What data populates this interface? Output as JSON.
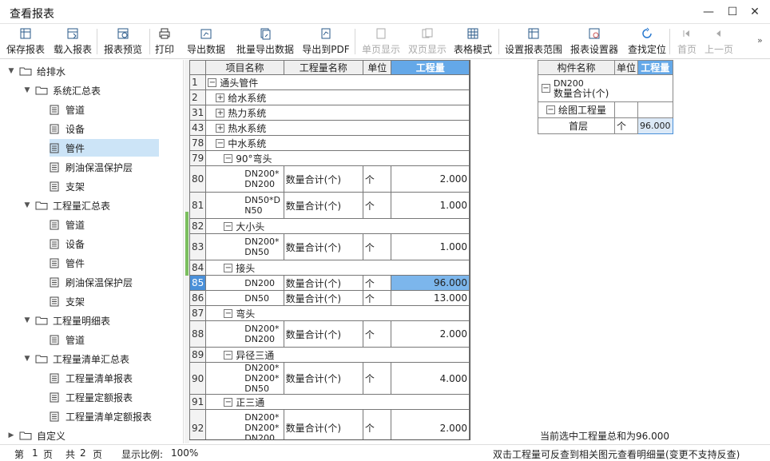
{
  "window": {
    "title": "查看报表"
  },
  "toolbar": {
    "items": [
      {
        "label": "保存报表",
        "icon": "table-save-icon"
      },
      {
        "label": "载入报表",
        "icon": "table-load-icon"
      },
      {
        "label": "报表预览",
        "icon": "table-preview-icon"
      },
      {
        "label": "打印",
        "icon": "printer-icon"
      },
      {
        "label": "导出数据",
        "icon": "export-data-icon"
      },
      {
        "label": "批量导出数据",
        "icon": "batch-export-icon"
      },
      {
        "label": "导出到PDF",
        "icon": "pdf-export-icon"
      },
      {
        "label": "单页显示",
        "icon": "single-page-icon"
      },
      {
        "label": "双页显示",
        "icon": "double-page-icon"
      },
      {
        "label": "表格模式",
        "icon": "grid-mode-icon"
      },
      {
        "label": "设置报表范围",
        "icon": "report-range-icon"
      },
      {
        "label": "报表设置器",
        "icon": "report-settings-icon"
      },
      {
        "label": "查找定位",
        "icon": "locate-icon"
      },
      {
        "label": "首页",
        "icon": "first-page-icon"
      },
      {
        "label": "上一页",
        "icon": "prev-page-icon"
      }
    ]
  },
  "tree": [
    {
      "label": "给排水",
      "level": 0,
      "type": "folder",
      "expanded": true
    },
    {
      "label": "系统汇总表",
      "level": 1,
      "type": "folder",
      "expanded": true
    },
    {
      "label": "管道",
      "level": 2,
      "type": "doc"
    },
    {
      "label": "设备",
      "level": 2,
      "type": "doc"
    },
    {
      "label": "管件",
      "level": 2,
      "type": "doc",
      "selected": true
    },
    {
      "label": "刷油保温保护层",
      "level": 2,
      "type": "doc"
    },
    {
      "label": "支架",
      "level": 2,
      "type": "doc"
    },
    {
      "label": "工程量汇总表",
      "level": 1,
      "type": "folder",
      "expanded": true
    },
    {
      "label": "管道",
      "level": 2,
      "type": "doc"
    },
    {
      "label": "设备",
      "level": 2,
      "type": "doc"
    },
    {
      "label": "管件",
      "level": 2,
      "type": "doc"
    },
    {
      "label": "刷油保温保护层",
      "level": 2,
      "type": "doc"
    },
    {
      "label": "支架",
      "level": 2,
      "type": "doc"
    },
    {
      "label": "工程量明细表",
      "level": 1,
      "type": "folder",
      "expanded": true
    },
    {
      "label": "管道",
      "level": 2,
      "type": "doc"
    },
    {
      "label": "工程量清单汇总表",
      "level": 1,
      "type": "folder",
      "expanded": true
    },
    {
      "label": "工程量清单报表",
      "level": 2,
      "type": "doc"
    },
    {
      "label": "工程量定额报表",
      "level": 2,
      "type": "doc"
    },
    {
      "label": "工程量清单定额报表",
      "level": 2,
      "type": "doc"
    },
    {
      "label": "自定义",
      "level": 0,
      "type": "folder",
      "expanded": false
    }
  ],
  "main_table": {
    "headers": [
      "项目名称",
      "工程量名称",
      "单位",
      "工程量"
    ],
    "rows": [
      {
        "n": "1",
        "kind": "group",
        "indent": 0,
        "sign": "−",
        "label": "通头管件"
      },
      {
        "n": "2",
        "kind": "group",
        "indent": 1,
        "sign": "+",
        "label": "给水系统"
      },
      {
        "n": "31",
        "kind": "group",
        "indent": 1,
        "sign": "+",
        "label": "热力系统"
      },
      {
        "n": "43",
        "kind": "group",
        "indent": 1,
        "sign": "+",
        "label": "热水系统"
      },
      {
        "n": "78",
        "kind": "group",
        "indent": 1,
        "sign": "−",
        "label": "中水系统"
      },
      {
        "n": "79",
        "kind": "group",
        "indent": 2,
        "sign": "−",
        "label": "90°弯头"
      },
      {
        "n": "80",
        "kind": "item",
        "name": "DN200*DN200",
        "qname": "数量合计(个)",
        "unit": "个",
        "value": "2.000",
        "tall": true
      },
      {
        "n": "81",
        "kind": "item",
        "name": "DN50*DN50",
        "qname": "数量合计(个)",
        "unit": "个",
        "value": "1.000",
        "tall": true
      },
      {
        "n": "82",
        "kind": "group",
        "indent": 2,
        "sign": "−",
        "label": "大小头"
      },
      {
        "n": "83",
        "kind": "item",
        "name": "DN200*DN50",
        "qname": "数量合计(个)",
        "unit": "个",
        "value": "1.000",
        "tall": true
      },
      {
        "n": "84",
        "kind": "group",
        "indent": 2,
        "sign": "−",
        "label": "接头"
      },
      {
        "n": "85",
        "kind": "item",
        "name": "DN200",
        "qname": "数量合计(个)",
        "unit": "个",
        "value": "96.000",
        "current": true
      },
      {
        "n": "86",
        "kind": "item",
        "name": "DN50",
        "qname": "数量合计(个)",
        "unit": "个",
        "value": "13.000"
      },
      {
        "n": "87",
        "kind": "group",
        "indent": 2,
        "sign": "−",
        "label": "弯头"
      },
      {
        "n": "88",
        "kind": "item",
        "name": "DN200*DN200",
        "qname": "数量合计(个)",
        "unit": "个",
        "value": "2.000",
        "tall": true
      },
      {
        "n": "89",
        "kind": "group",
        "indent": 2,
        "sign": "−",
        "label": "异径三通"
      },
      {
        "n": "90",
        "kind": "item",
        "name": "DN200*DN200*DN50",
        "qname": "数量合计(个)",
        "unit": "个",
        "value": "4.000",
        "tall": true
      },
      {
        "n": "91",
        "kind": "group",
        "indent": 2,
        "sign": "−",
        "label": "正三通"
      },
      {
        "n": "92",
        "kind": "item",
        "name": "DN200*DN200*DN200",
        "qname": "数量合计(个)",
        "unit": "个",
        "value": "2.000",
        "tall3": true
      }
    ]
  },
  "side_table": {
    "headers": [
      "构件名称",
      "单位",
      "工程量"
    ],
    "group_title_1": "DN200",
    "group_title_2": "数量合计(个)",
    "sub_group": "绘图工程量",
    "row": {
      "name": "首层",
      "unit": "个",
      "value": "96.000"
    }
  },
  "summary": "当前选中工程量总和为96.000",
  "status": {
    "page_label": "第",
    "page_current": "1",
    "page_unit": "页",
    "total_label": "共",
    "total_pages": "2",
    "total_unit": "页",
    "zoom_label": "显示比例:",
    "zoom": "100%",
    "hint": "双击工程量可反查到相关图元查看明细量(变更不支持反查)"
  }
}
